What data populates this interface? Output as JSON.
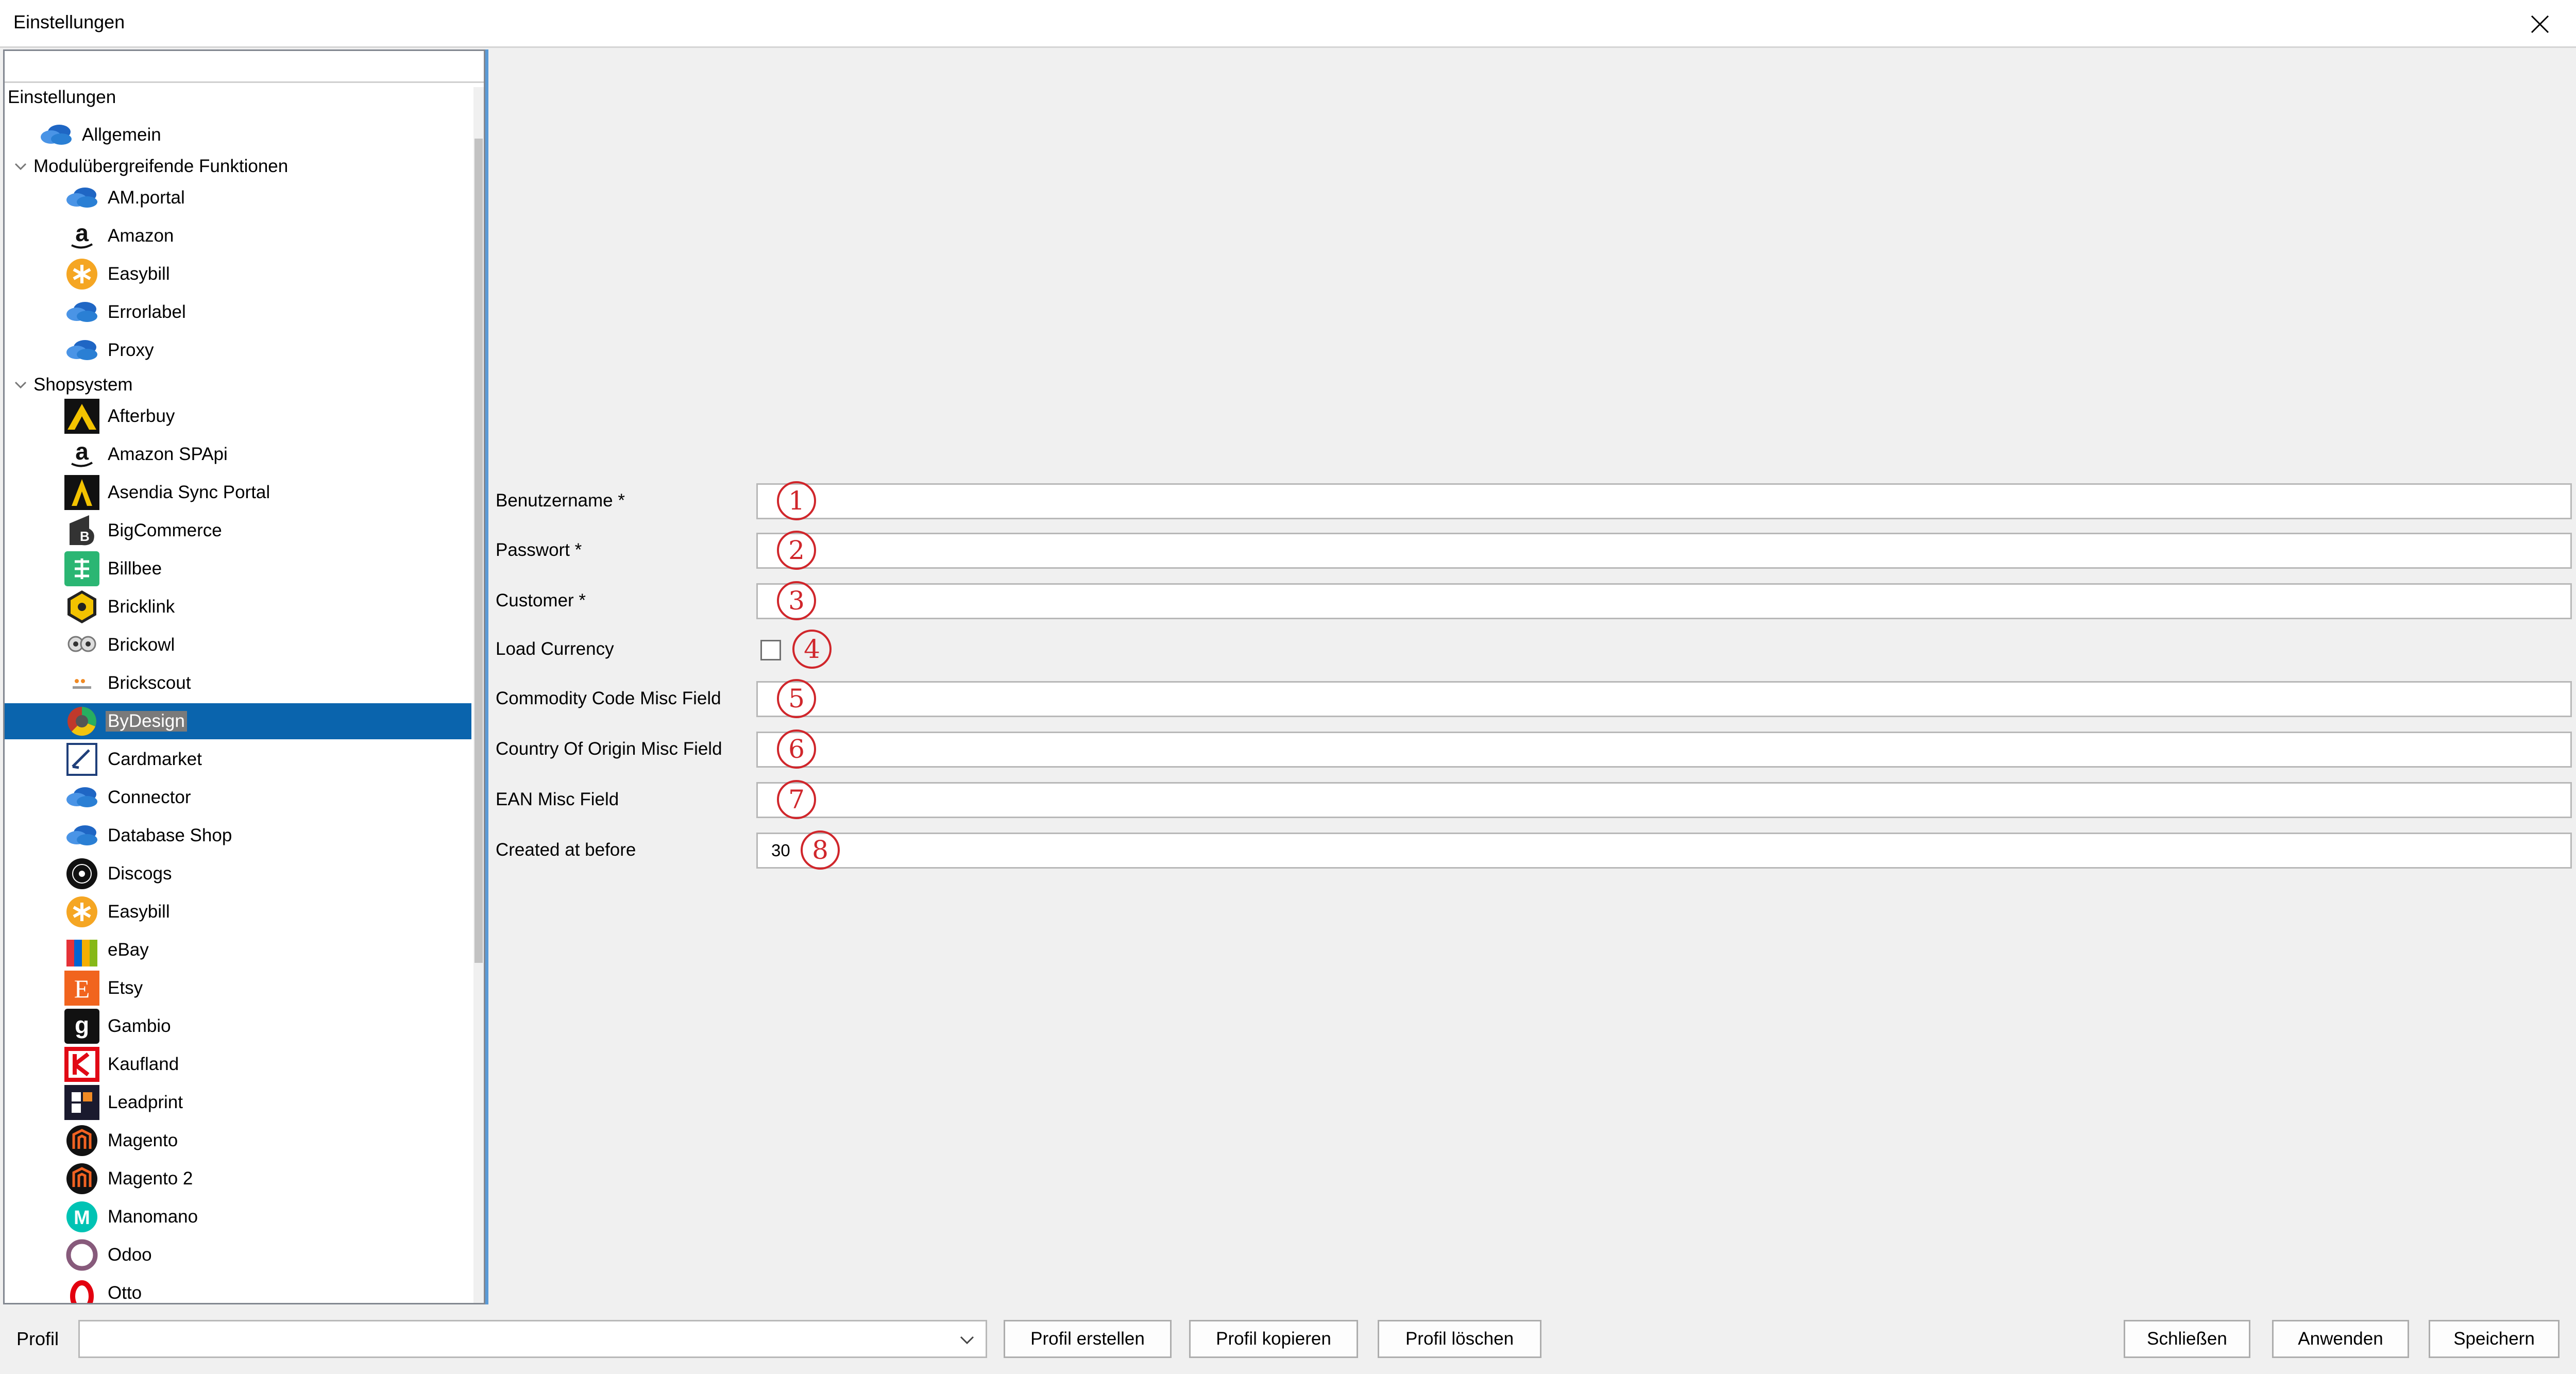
{
  "window": {
    "title": "Einstellungen"
  },
  "sidebar": {
    "root_label": "Einstellungen",
    "top_items": [
      {
        "label": "Allgemein",
        "icon": "cloud-icon"
      }
    ],
    "groups": [
      {
        "label": "Modulübergreifende Funktionen",
        "items": [
          {
            "label": "AM.portal",
            "icon": "cloud-icon"
          },
          {
            "label": "Amazon",
            "icon": "amazon-icon"
          },
          {
            "label": "Easybill",
            "icon": "easybill-icon"
          },
          {
            "label": "Errorlabel",
            "icon": "cloud-icon"
          },
          {
            "label": "Proxy",
            "icon": "cloud-icon"
          }
        ]
      },
      {
        "label": "Shopsystem",
        "items": [
          {
            "label": "Afterbuy",
            "icon": "afterbuy-icon"
          },
          {
            "label": "Amazon SPApi",
            "icon": "amazon-icon"
          },
          {
            "label": "Asendia Sync Portal",
            "icon": "asendia-icon"
          },
          {
            "label": "BigCommerce",
            "icon": "bigcommerce-icon"
          },
          {
            "label": "Billbee",
            "icon": "billbee-icon"
          },
          {
            "label": "Bricklink",
            "icon": "bricklink-icon"
          },
          {
            "label": "Brickowl",
            "icon": "brickowl-icon"
          },
          {
            "label": "Brickscout",
            "icon": "brickscout-icon"
          },
          {
            "label": "ByDesign",
            "icon": "bydesign-icon",
            "selected": true
          },
          {
            "label": "Cardmarket",
            "icon": "cardmarket-icon"
          },
          {
            "label": "Connector",
            "icon": "cloud-icon"
          },
          {
            "label": "Database Shop",
            "icon": "cloud-icon"
          },
          {
            "label": "Discogs",
            "icon": "discogs-icon"
          },
          {
            "label": "Easybill",
            "icon": "easybill-icon"
          },
          {
            "label": "eBay",
            "icon": "ebay-icon"
          },
          {
            "label": "Etsy",
            "icon": "etsy-icon"
          },
          {
            "label": "Gambio",
            "icon": "gambio-icon"
          },
          {
            "label": "Kaufland",
            "icon": "kaufland-icon"
          },
          {
            "label": "Leadprint",
            "icon": "leadprint-icon"
          },
          {
            "label": "Magento",
            "icon": "magento-icon"
          },
          {
            "label": "Magento 2",
            "icon": "magento-icon"
          },
          {
            "label": "Manomano",
            "icon": "manomano-icon"
          },
          {
            "label": "Odoo",
            "icon": "odoo-icon"
          },
          {
            "label": "Otto",
            "icon": "otto-icon"
          }
        ]
      }
    ]
  },
  "form": {
    "fields": [
      {
        "label": "Benutzername *",
        "value": "",
        "badge": "1"
      },
      {
        "label": "Passwort *",
        "value": "",
        "badge": "2"
      },
      {
        "label": "Customer *",
        "value": "",
        "badge": "3"
      },
      {
        "label": "Load Currency",
        "type": "checkbox",
        "checked": false,
        "badge": "4"
      },
      {
        "label": "Commodity Code Misc Field",
        "value": "",
        "badge": "5"
      },
      {
        "label": "Country Of Origin Misc Field",
        "value": "",
        "badge": "6"
      },
      {
        "label": "EAN Misc Field",
        "value": "",
        "badge": "7"
      },
      {
        "label": "Created at before",
        "value": "30",
        "badge": "8"
      }
    ]
  },
  "footer": {
    "profile_label": "Profil",
    "profile_value": "",
    "buttons": {
      "create": "Profil erstellen",
      "copy": "Profil kopieren",
      "delete": "Profil löschen",
      "close": "Schließen",
      "apply": "Anwenden",
      "save": "Speichern"
    }
  },
  "colors": {
    "selection": "#0a64ad",
    "badge": "#d0262b",
    "cloud": "#2a7fd4"
  }
}
